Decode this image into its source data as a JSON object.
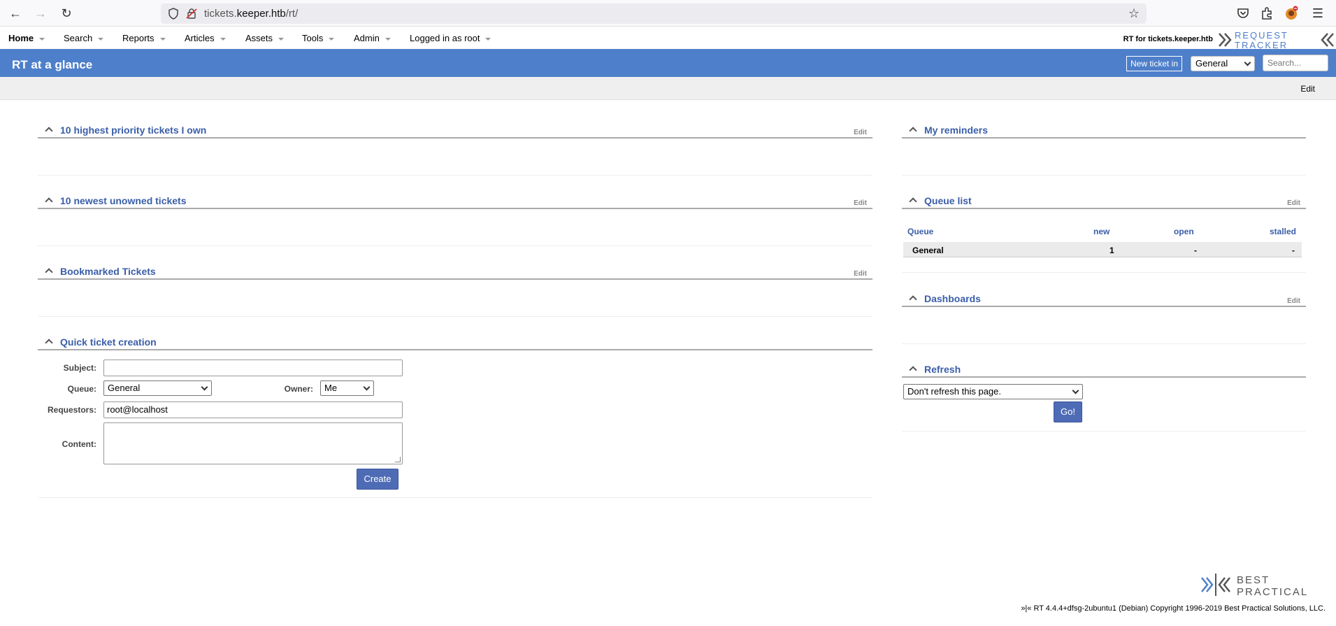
{
  "browser": {
    "url_host_prefix": "tickets.",
    "url_host": "keeper.htb",
    "url_path": "/rt/"
  },
  "topnav": {
    "items": [
      {
        "label": "Home",
        "active": true
      },
      {
        "label": "Search"
      },
      {
        "label": "Reports"
      },
      {
        "label": "Articles"
      },
      {
        "label": "Assets"
      },
      {
        "label": "Tools"
      },
      {
        "label": "Admin"
      },
      {
        "label": "Logged in as root"
      }
    ],
    "rt_for": "RT for tickets.keeper.htb",
    "logo_top": "REQUEST",
    "logo_bottom": "TRACKER"
  },
  "header": {
    "title": "RT at a glance",
    "new_ticket_label": "New ticket in",
    "queue_value": "General",
    "search_placeholder": "Search..."
  },
  "subbar": {
    "edit_label": "Edit"
  },
  "left": {
    "priority": {
      "title": "10 highest priority tickets I own",
      "edit": "Edit"
    },
    "unowned": {
      "title": "10 newest unowned tickets",
      "edit": "Edit"
    },
    "bookmarked": {
      "title": "Bookmarked Tickets",
      "edit": "Edit"
    },
    "quick": {
      "title": "Quick ticket creation",
      "subject_label": "Subject:",
      "subject_value": "",
      "queue_label": "Queue:",
      "queue_value": "General",
      "owner_label": "Owner:",
      "owner_value": "Me",
      "requestors_label": "Requestors:",
      "requestors_value": "root@localhost",
      "content_label": "Content:",
      "create_label": "Create"
    }
  },
  "right": {
    "reminders": {
      "title": "My reminders"
    },
    "queue_list": {
      "title": "Queue list",
      "edit": "Edit",
      "headers": {
        "queue": "Queue",
        "new": "new",
        "open": "open",
        "stalled": "stalled"
      },
      "rows": [
        {
          "queue": "General",
          "new": "1",
          "open": "-",
          "stalled": "-"
        }
      ]
    },
    "dashboards": {
      "title": "Dashboards",
      "edit": "Edit"
    },
    "refresh": {
      "title": "Refresh",
      "select_value": "Don't refresh this page.",
      "go_label": "Go!"
    }
  },
  "footer": {
    "logo_top": "BEST",
    "logo_bottom": "PRACTICAL",
    "copyright": "»|« RT 4.4.4+dfsg-2ubuntu1 (Debian) Copyright 1996-2019 Best Practical Solutions, LLC."
  },
  "colors": {
    "header_blue": "#4e7fca",
    "link_blue": "#3a5ea8",
    "button_blue": "#4e6bb5"
  }
}
